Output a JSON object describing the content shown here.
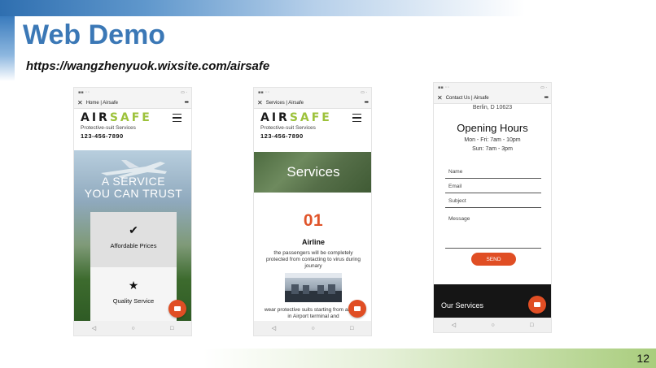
{
  "slide": {
    "title": "Web Demo",
    "url": "https://wangzhenyuok.wixsite.com/airsafe",
    "page_number": "12"
  },
  "brand": {
    "logo_part1": "AIR",
    "logo_part2": "SAFE",
    "tagline": "Protective-suit Services",
    "phone": "123-456-7890"
  },
  "phones": {
    "home": {
      "tab_title": "Home | Airsafe",
      "hero_line1": "A SERVICE",
      "hero_line2": "YOU CAN TRUST",
      "card1_label": "Affordable Prices",
      "card2_label": "Quality Service"
    },
    "services": {
      "tab_title": "Services | Airsafe",
      "banner": "Services",
      "number": "01",
      "heading": "Airline",
      "description": "the passengers will be completely protected from contacting to virus during jounary",
      "description2": "wear protective suits starting from arriving in Airport terminal and"
    },
    "contact": {
      "tab_title": "Contact Us | Airsafe",
      "address_fragment": "Berlin, D 10623",
      "opening_title": "Opening Hours",
      "hours_weekday": "Mon - Fri: 7am - 10pm",
      "hours_sunday": "Sun: 7am - 3pm",
      "field_name": "Name",
      "field_email": "Email",
      "field_subject": "Subject",
      "field_message": "Message",
      "send_label": "SEND",
      "our_services": "Our Services"
    }
  },
  "colors": {
    "accent": "#e04e24",
    "title_blue": "#3b78b6",
    "logo_green": "#9dc23b"
  }
}
